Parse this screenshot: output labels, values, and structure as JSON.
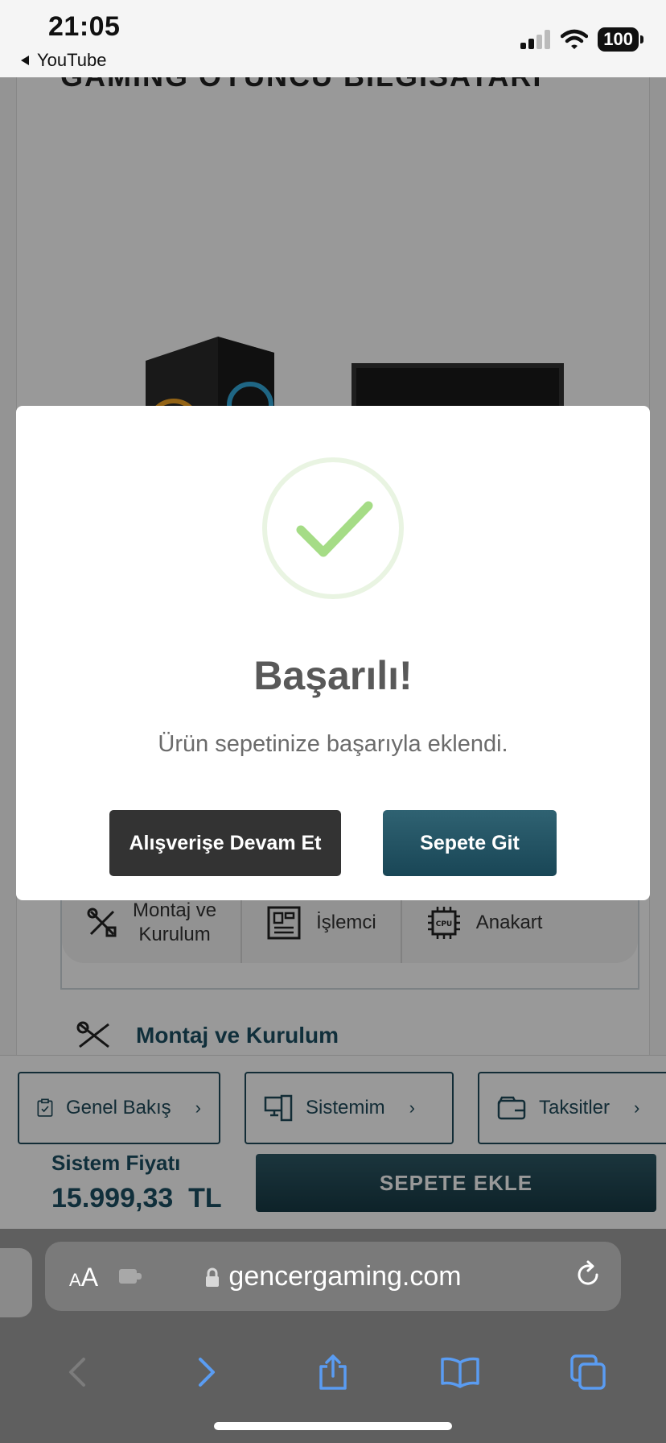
{
  "status_bar": {
    "time": "21:05",
    "back_app": "YouTube",
    "battery": "100"
  },
  "page": {
    "product_title": "GAMING OYUNCU BİLGİSAYARI",
    "tabs": [
      {
        "label": "Montaj ve\nKurulum",
        "icon": "tools-icon"
      },
      {
        "label": "İşlemci",
        "icon": "motherboard-icon"
      },
      {
        "label": "Anakart",
        "icon": "cpu-icon"
      }
    ],
    "section_title": "Montaj ve Kurulum"
  },
  "bottom_bar": {
    "nav": [
      {
        "label": "Genel Bakış",
        "icon": "clipboard-icon"
      },
      {
        "label": "Sistemim",
        "icon": "computer-icon"
      },
      {
        "label": "Taksitler",
        "icon": "wallet-icon"
      }
    ],
    "price_label": "Sistem Fiyatı",
    "price_value": "15.999,33  TL",
    "add_to_cart": "SEPETE EKLE"
  },
  "modal": {
    "title": "Başarılı!",
    "message": "Ürün sepetinize başarıyla eklendi.",
    "continue_button": "Alışverişe Devam Et",
    "cart_button": "Sepete Git",
    "success_color": "#a5dc86"
  },
  "safari": {
    "text_size": "AA",
    "url": "gencergaming.com"
  }
}
